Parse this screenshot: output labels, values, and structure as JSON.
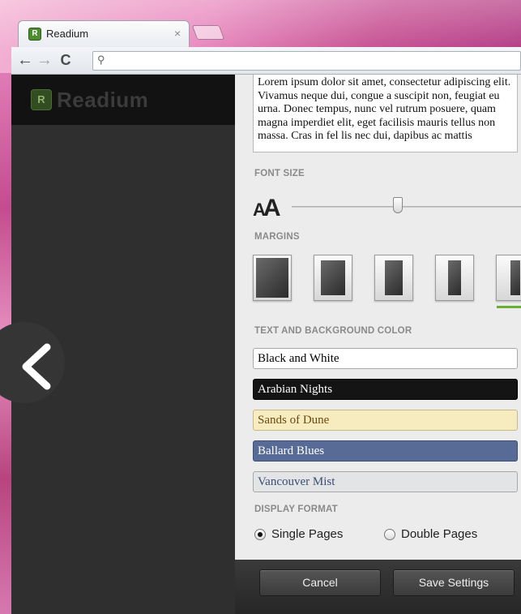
{
  "browser": {
    "tab_title": "Readium",
    "tab_close": "×",
    "nav": {
      "back": "←",
      "forward": "→",
      "reload": "C"
    },
    "omnibox_icon": "search-icon"
  },
  "app": {
    "logo_text": "Readium"
  },
  "settings": {
    "preview_text": "Lorem ipsum dolor sit amet, consectetur adipiscing elit. Vivamus neque dui, congue a suscipit non, feugiat eu urna. Donec tempus, nunc vel rutrum posuere, quam magna imperdiet elit, eget facilisis mauris tellus non massa. Cras in fel lis nec dui, dapibus ac mattis",
    "font_size_label": "FONT SIZE",
    "font_size_value": 0.6,
    "margins_label": "MARGINS",
    "margin_options": [
      "margin-1",
      "margin-2",
      "margin-3",
      "margin-4",
      "margin-5"
    ],
    "margin_selected": 5,
    "color_label": "TEXT AND BACKGROUND COLOR",
    "color_options": [
      {
        "label": "Black and White",
        "bg": "#ffffff",
        "fg": "#000000"
      },
      {
        "label": "Arabian Nights",
        "bg": "#141414",
        "fg": "#ffffff"
      },
      {
        "label": "Sands of Dune",
        "bg": "#f7ecc0",
        "fg": "#6b4a10"
      },
      {
        "label": "Ballard Blues",
        "bg": "#576b96",
        "fg": "#ffffff"
      },
      {
        "label": "Vancouver Mist",
        "bg": "#e3e4e6",
        "fg": "#3a4e73"
      }
    ],
    "display_label": "DISPLAY FORMAT",
    "single_pages": "Single Pages",
    "double_pages": "Double Pages",
    "single_selected": true,
    "cancel": "Cancel",
    "save": "Save Settings"
  },
  "colors": {
    "accent_green": "#69b030"
  }
}
